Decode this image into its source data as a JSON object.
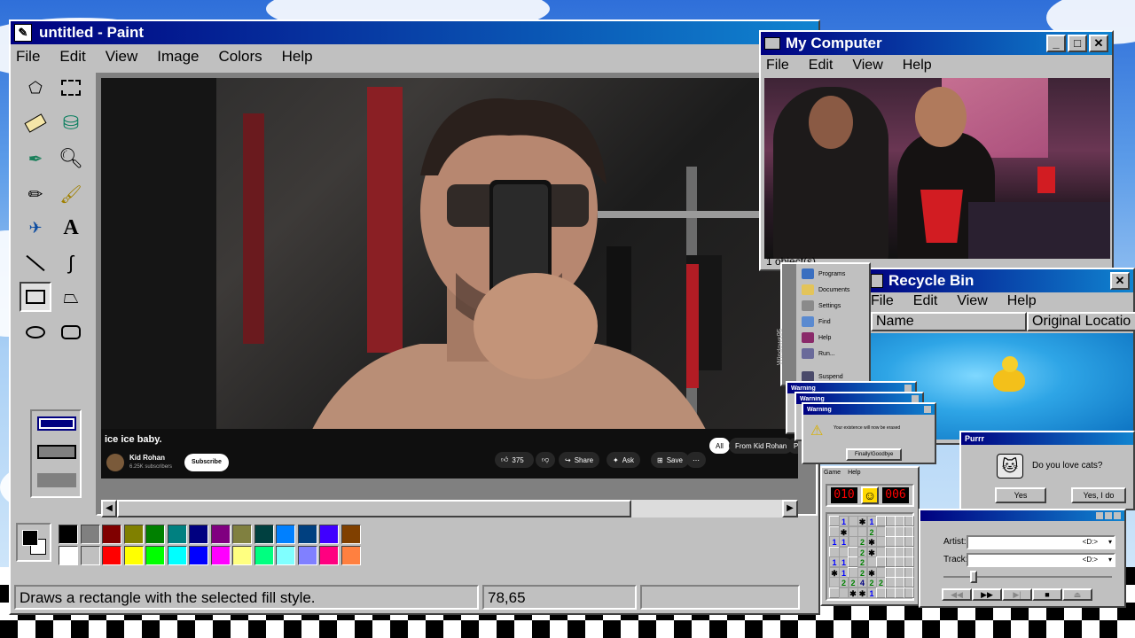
{
  "paint": {
    "title": "untitled - Paint",
    "menu": [
      "File",
      "Edit",
      "View",
      "Image",
      "Colors",
      "Help"
    ],
    "tools": [
      "free-select",
      "select",
      "eraser",
      "fill",
      "color-picker",
      "magnifier",
      "pencil",
      "brush",
      "airbrush",
      "text",
      "line",
      "curve",
      "rectangle",
      "polygon",
      "ellipse",
      "rounded-rectangle"
    ],
    "active_tool": "rectangle",
    "status_text": "Draws a rectangle with the selected fill style.",
    "coords": "78,65",
    "palette_top": [
      "#000000",
      "#808080",
      "#800000",
      "#808000",
      "#008000",
      "#008080",
      "#000080",
      "#800080",
      "#808040",
      "#004040",
      "#0080ff",
      "#004080",
      "#4000ff",
      "#804000"
    ],
    "palette_bottom": [
      "#ffffff",
      "#c0c0c0",
      "#ff0000",
      "#ffff00",
      "#00ff00",
      "#00ffff",
      "#0000ff",
      "#ff00ff",
      "#ffff80",
      "#00ff80",
      "#80ffff",
      "#8080ff",
      "#ff0080",
      "#ff8040"
    ],
    "fg_color": "#000000",
    "bg_color": "#ffffff"
  },
  "youtube": {
    "video_title": "ice ice baby.",
    "channel": "Kid Rohan",
    "subscribers": "6.25K subscribers",
    "subscribe": "Subscribe",
    "likes": "375",
    "share": "Share",
    "ask": "Ask",
    "save": "Save",
    "chips": [
      "All",
      "From Kid Rohan",
      "Po"
    ]
  },
  "my_computer": {
    "title": "My Computer",
    "menu": [
      "File",
      "Edit",
      "View",
      "Help"
    ],
    "status": "1 object(s)"
  },
  "recycle_bin": {
    "title": "Recycle Bin",
    "menu": [
      "File",
      "Edit",
      "View",
      "Help"
    ],
    "columns": [
      "Name",
      "Original Locatio"
    ]
  },
  "start_menu": {
    "side_text": "Windows95",
    "items": [
      "Programs",
      "Documents",
      "Settings",
      "Find",
      "Help",
      "Run...",
      "Suspend"
    ]
  },
  "warnings": {
    "title": "Warning",
    "message": "Your existence will now be erased",
    "button": "Finally!Goodbye"
  },
  "minesweeper": {
    "menu": [
      "Game",
      "Help"
    ],
    "mines_left": "010",
    "timer": "006",
    "smiley": "☺"
  },
  "purr": {
    "title": "Purrr",
    "question": "Do you love cats?",
    "yes": "Yes",
    "yes_i_do": "Yes, I do"
  },
  "cd_player": {
    "artist_label": "Artist:",
    "track_label": "Track:",
    "artist_value": "<D:>",
    "track_value": "<D:>"
  },
  "colors": {
    "title_start": "#000080",
    "title_end": "#1084d0",
    "face": "#c0c0c0"
  }
}
